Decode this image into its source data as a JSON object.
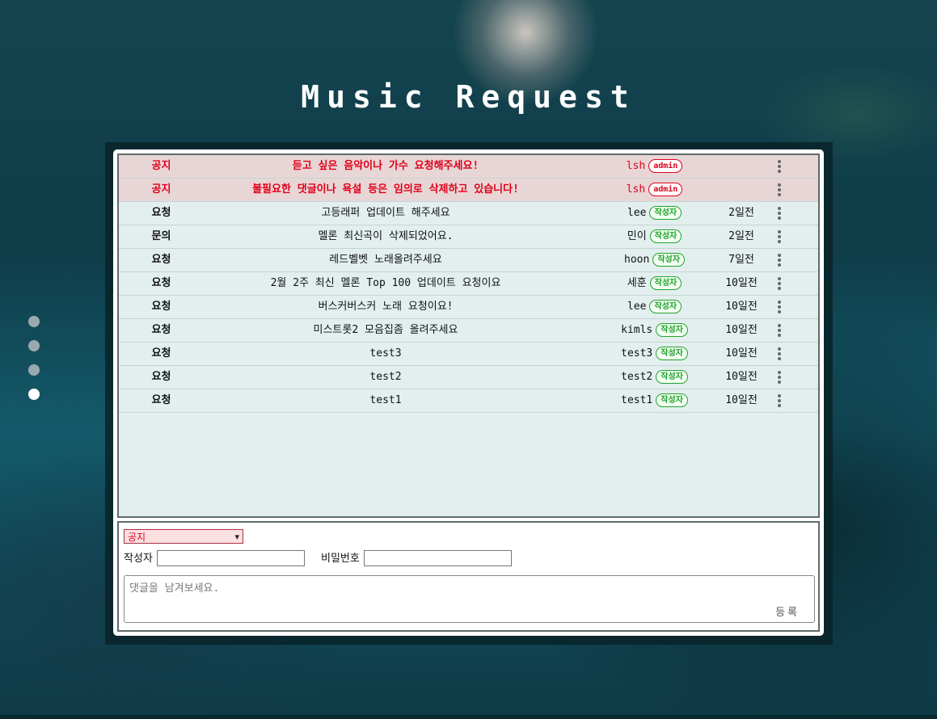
{
  "header": {
    "title": "Music Request"
  },
  "pager": {
    "dots": [
      false,
      false,
      false,
      true
    ]
  },
  "rows": [
    {
      "category": "공지",
      "title": "듣고 싶은 음악이나 가수 요청해주세요!",
      "author": "lsh",
      "badge": "admin",
      "date": "",
      "notice": true
    },
    {
      "category": "공지",
      "title": "불필요한 댓글이나 욕설 등은 임의로 삭제하고 있습니다!",
      "author": "lsh",
      "badge": "admin",
      "date": "",
      "notice": true
    },
    {
      "category": "요청",
      "title": "고등래퍼 업데이트 해주세요",
      "author": "lee",
      "badge": "작성자",
      "date": "2일전",
      "notice": false
    },
    {
      "category": "문의",
      "title": "멜론 최신곡이 삭제되었어요.",
      "author": "민이",
      "badge": "작성자",
      "date": "2일전",
      "notice": false
    },
    {
      "category": "요청",
      "title": "레드벨벳 노래올려주세요",
      "author": "hoon",
      "badge": "작성자",
      "date": "7일전",
      "notice": false
    },
    {
      "category": "요청",
      "title": "2월 2주 최신 멜론 Top 100 업데이트 요청이요",
      "author": "세훈",
      "badge": "작성자",
      "date": "10일전",
      "notice": false
    },
    {
      "category": "요청",
      "title": "버스커버스커 노래 요청이요!",
      "author": "lee",
      "badge": "작성자",
      "date": "10일전",
      "notice": false
    },
    {
      "category": "요청",
      "title": "미스트롯2 모음집좀 올려주세요",
      "author": "kimls",
      "badge": "작성자",
      "date": "10일전",
      "notice": false
    },
    {
      "category": "요청",
      "title": "test3",
      "author": "test3",
      "badge": "작성자",
      "date": "10일전",
      "notice": false
    },
    {
      "category": "요청",
      "title": "test2",
      "author": "test2",
      "badge": "작성자",
      "date": "10일전",
      "notice": false
    },
    {
      "category": "요청",
      "title": "test1",
      "author": "test1",
      "badge": "작성자",
      "date": "10일전",
      "notice": false
    }
  ],
  "form": {
    "category_selected": "공지",
    "author_label": "작성자",
    "password_label": "비밀번호",
    "comment_placeholder": "댓글을 남겨보세요.",
    "submit_label": "등록"
  },
  "colors": {
    "notice_text": "#e0001b",
    "notice_row": "#e8d6d6",
    "list_bg": "#e3efef",
    "admin_badge": "#e0001b",
    "writer_badge": "#21a32b"
  },
  "icons": {
    "row_menu": "kebab-menu-icon",
    "select_caret": "chevron-down-icon"
  }
}
